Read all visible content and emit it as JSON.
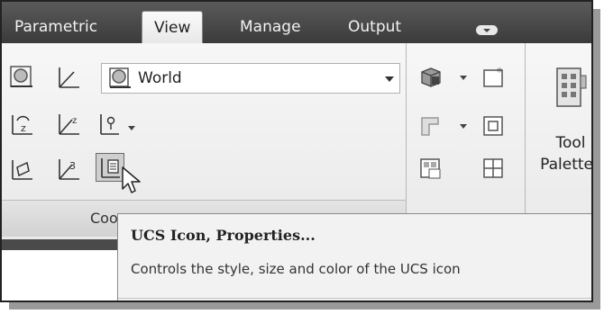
{
  "tabs": [
    {
      "label": "Parametric"
    },
    {
      "label": "View"
    },
    {
      "label": "Manage"
    },
    {
      "label": "Output"
    }
  ],
  "active_tab": "View",
  "coordinates_panel": {
    "ucs_combo": {
      "value": "World"
    },
    "panel_title_visible": "Coordinates"
  },
  "tool_palettes": {
    "line1": "Tool",
    "line2": "Palettes"
  },
  "tooltip": {
    "title": "UCS Icon, Properties...",
    "description": "Controls the style, size and color of the UCS icon"
  },
  "colors": {
    "tab_bar": "#3f3f3f",
    "ribbon_bg": "#f0f0f0",
    "tooltip_bg": "#f2f2f2"
  }
}
